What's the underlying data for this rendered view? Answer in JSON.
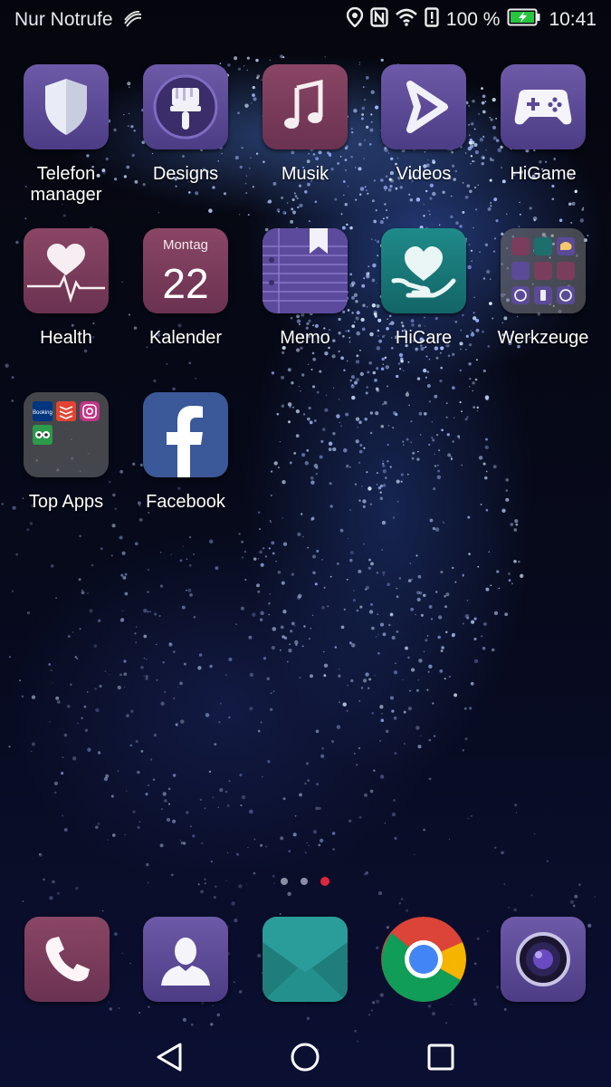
{
  "status_bar": {
    "carrier": "Nur Notrufe",
    "battery": "100 %",
    "time": "10:41",
    "icons": [
      "swipe-keyboard-icon",
      "location-icon",
      "nfc-icon",
      "wifi-icon",
      "alert-icon",
      "battery-charging-icon"
    ]
  },
  "apps": [
    {
      "label": "Telefon\nmanager",
      "icon": "shield-icon"
    },
    {
      "label": "Designs",
      "icon": "paintbrush-icon"
    },
    {
      "label": "Musik",
      "icon": "music-note-icon"
    },
    {
      "label": "Videos",
      "icon": "play-icon"
    },
    {
      "label": "HiGame",
      "icon": "gamepad-icon"
    },
    {
      "label": "Health",
      "icon": "heart-pulse-icon"
    },
    {
      "label": "Kalender",
      "icon": "calendar-icon",
      "day_name": "Montag",
      "day_number": "22"
    },
    {
      "label": "Memo",
      "icon": "notepad-icon"
    },
    {
      "label": "HiCare",
      "icon": "heart-hand-icon"
    },
    {
      "label": "Werkzeuge",
      "icon": "tools-folder-icon"
    },
    {
      "label": "Top Apps",
      "icon": "apps-folder-icon",
      "folder_items": [
        "Booking",
        "todoist",
        "instagram",
        "tripadvisor"
      ]
    },
    {
      "label": "Facebook",
      "icon": "facebook-icon"
    }
  ],
  "page_indicator": {
    "pages": 3,
    "current": 3
  },
  "dock": [
    {
      "name": "Telefon",
      "icon": "phone-icon"
    },
    {
      "name": "Kontakte",
      "icon": "contacts-icon"
    },
    {
      "name": "Nachrichten",
      "icon": "envelope-icon"
    },
    {
      "name": "Chrome",
      "icon": "chrome-icon"
    },
    {
      "name": "Kamera",
      "icon": "camera-icon"
    }
  ],
  "nav": [
    "back-icon",
    "home-icon",
    "recents-icon"
  ],
  "colors": {
    "active_dot": "#e0263a",
    "purple_tile": "#5b4a97",
    "wine_tile": "#7a3d5b",
    "teal_tile": "#1a7a7a",
    "facebook": "#3b5998"
  }
}
